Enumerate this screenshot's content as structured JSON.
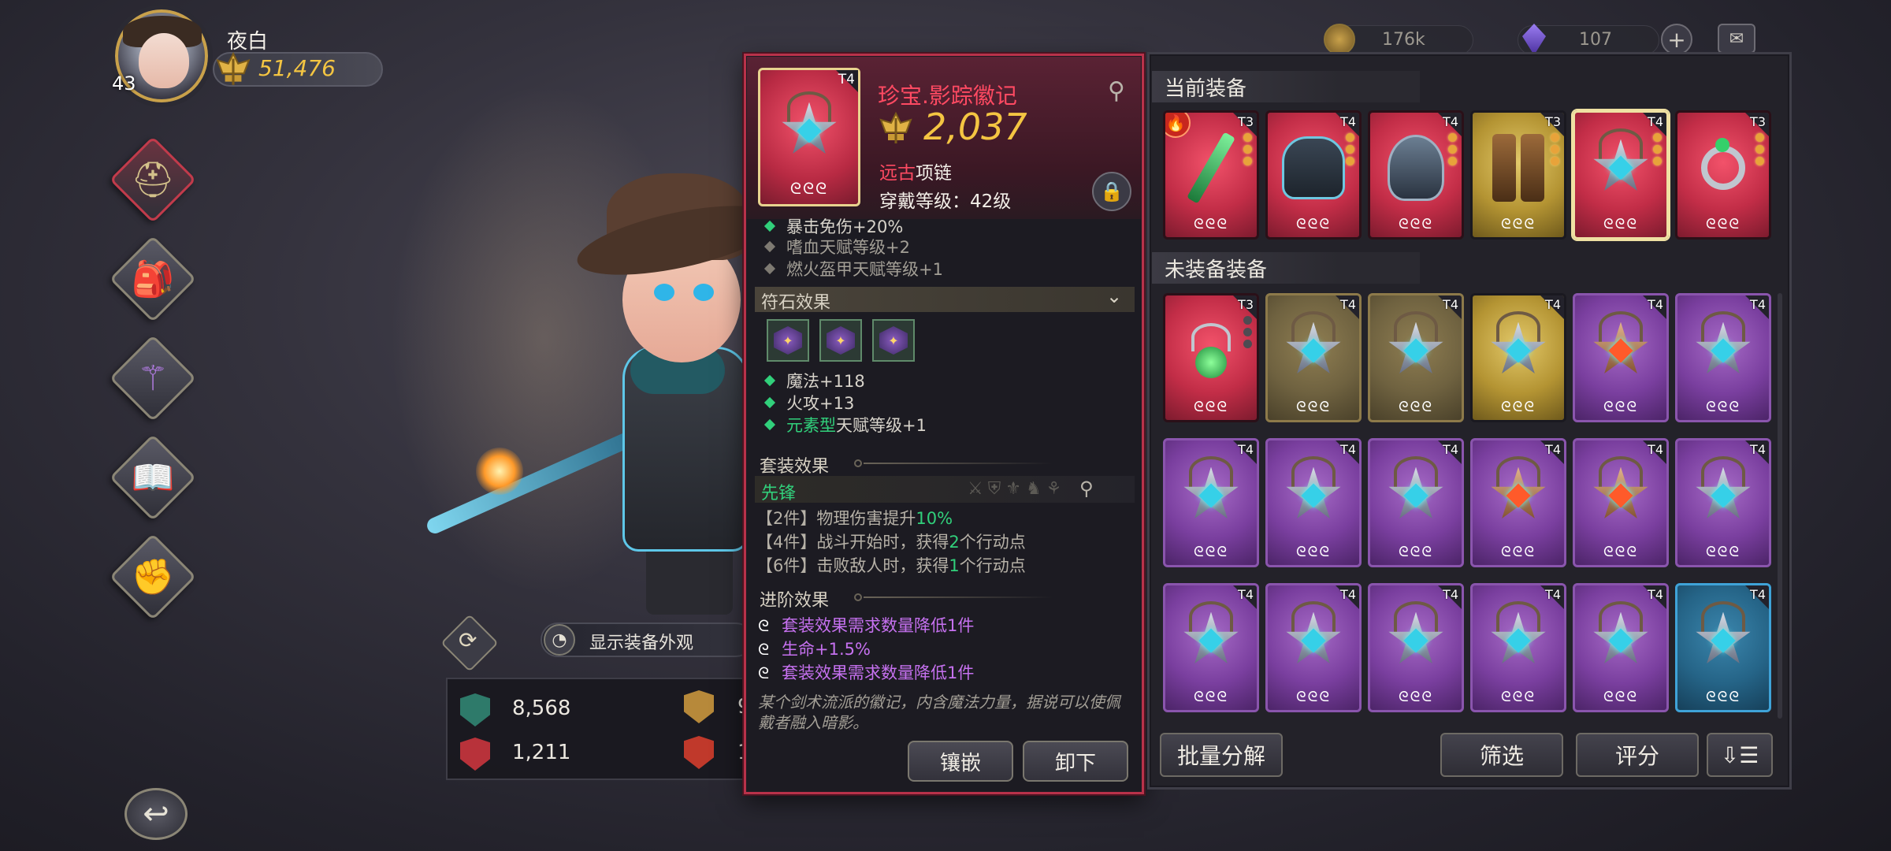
{
  "player": {
    "name": "夜白",
    "level": "43",
    "power": "51,476"
  },
  "currency": {
    "gold": "176k",
    "gems": "107"
  },
  "nav": {
    "items": [
      "equipment-helmet",
      "backpack",
      "rune-altar",
      "spellbook",
      "upgrade"
    ],
    "active_index": 0
  },
  "appearance": {
    "toggle_label": "显示装备外观"
  },
  "stats": {
    "hp": "8,568",
    "attack": "1,211",
    "defense_partial": "9",
    "fire_partial": "1"
  },
  "tooltip": {
    "tier": "T4",
    "name": "珍宝.影踪徽记",
    "power": "2,037",
    "quality": "远古",
    "type": "项链",
    "requirement": "穿戴等级：42级",
    "base_lines": [
      {
        "text": "暴击免伤+20%",
        "active": true
      },
      {
        "text": "嗜血天赋等级+2",
        "active": false
      },
      {
        "text": "燃火盔甲天赋等级+1",
        "active": false
      }
    ],
    "rune_section": {
      "title": "符石效果",
      "lines": [
        {
          "text": "魔法+118"
        },
        {
          "text": "火攻+13"
        },
        {
          "prefix": "元素型",
          "text": "天赋等级+1"
        }
      ]
    },
    "set_section": {
      "title": "套装效果",
      "set_name": "先锋",
      "lines": [
        {
          "pre": "【2件】物理伤害提升",
          "val": "10%",
          "post": ""
        },
        {
          "pre": "【4件】战斗开始时，获得",
          "val": "2",
          "post": "个行动点"
        },
        {
          "pre": "【6件】击败敌人时，获得",
          "val": "1",
          "post": "个行动点"
        }
      ]
    },
    "advance_section": {
      "title": "进阶效果",
      "lines": [
        "套装效果需求数量降低1件",
        "生命+1.5%",
        "套装效果需求数量降低1件"
      ]
    },
    "flavor": "某个剑术流派的徽记，内含魔法力量，据说可以使佩戴者融入暗影。",
    "buttons": {
      "socket": "镶嵌",
      "unequip": "卸下"
    }
  },
  "panel": {
    "current_title": "当前装备",
    "unequipped_title": "未装备装备",
    "current_items": [
      {
        "name": "green-sword",
        "tier": "T3",
        "rarity": "red"
      },
      {
        "name": "hood-armor",
        "tier": "T4",
        "rarity": "red"
      },
      {
        "name": "helmet",
        "tier": "T4",
        "rarity": "red"
      },
      {
        "name": "boots",
        "tier": "T3",
        "rarity": "gold"
      },
      {
        "name": "amulet",
        "tier": "T4",
        "rarity": "red"
      },
      {
        "name": "ring",
        "tier": "T3",
        "rarity": "red"
      }
    ],
    "inventory_items": [
      {
        "name": "green-amulet",
        "tier": "T3",
        "rarity": "red"
      },
      {
        "name": "amulet",
        "tier": "T4",
        "rarity": "olive"
      },
      {
        "name": "amulet",
        "tier": "T4",
        "rarity": "olive"
      },
      {
        "name": "amulet",
        "tier": "T4",
        "rarity": "gold"
      },
      {
        "name": "fire-amulet",
        "tier": "T4",
        "rarity": "purple"
      },
      {
        "name": "amulet",
        "tier": "T4",
        "rarity": "purple"
      },
      {
        "name": "amulet",
        "tier": "T4",
        "rarity": "purple"
      },
      {
        "name": "amulet",
        "tier": "T4",
        "rarity": "purple"
      },
      {
        "name": "amulet",
        "tier": "T4",
        "rarity": "purple"
      },
      {
        "name": "fire-amulet",
        "tier": "T4",
        "rarity": "purple"
      },
      {
        "name": "fire-amulet",
        "tier": "T4",
        "rarity": "purple"
      },
      {
        "name": "amulet",
        "tier": "T4",
        "rarity": "purple"
      },
      {
        "name": "amulet",
        "tier": "T4",
        "rarity": "purple"
      },
      {
        "name": "amulet",
        "tier": "T4",
        "rarity": "purple"
      },
      {
        "name": "amulet",
        "tier": "T4",
        "rarity": "purple"
      },
      {
        "name": "amulet",
        "tier": "T4",
        "rarity": "purple"
      },
      {
        "name": "amulet",
        "tier": "T4",
        "rarity": "purple"
      },
      {
        "name": "amulet",
        "tier": "T4",
        "rarity": "blue"
      }
    ],
    "buttons": {
      "batch_salvage": "批量分解",
      "filter": "筛选",
      "score": "评分"
    }
  },
  "colors": {
    "quality_red": "#ff4a62",
    "power_gold": "#f4c542",
    "effect_green": "#31d07b",
    "advance_purple": "#c671f0"
  }
}
